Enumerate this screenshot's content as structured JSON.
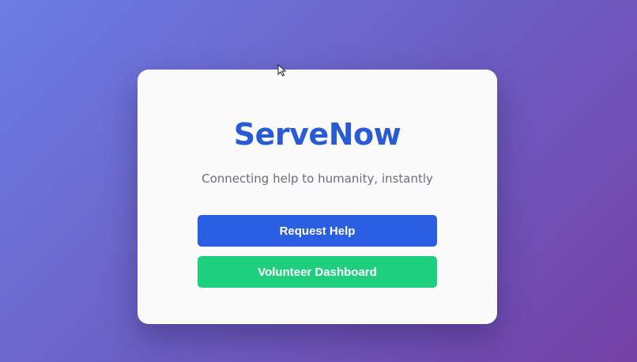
{
  "app": {
    "brand": "ServeNow",
    "tagline": "Connecting help to humanity, instantly"
  },
  "actions": {
    "request_help_label": "Request Help",
    "volunteer_dashboard_label": "Volunteer Dashboard"
  },
  "colors": {
    "brand": "#2a5bd7",
    "request_button": "#2a5ee3",
    "volunteer_button": "#1ecf7d",
    "background_start": "#6b7de3",
    "background_end": "#7441a6"
  },
  "icons": {
    "cursor": "mouse-pointer-icon"
  }
}
